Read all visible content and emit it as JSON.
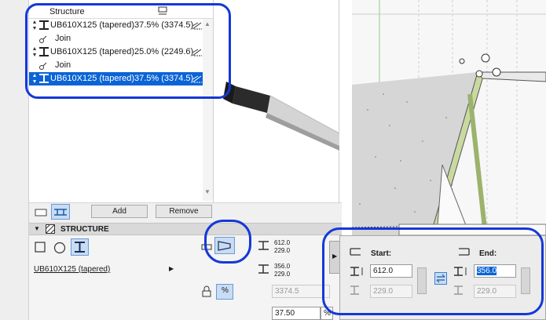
{
  "segments": {
    "header": "Structure",
    "rows": [
      {
        "type": "segment",
        "name": "UB610X125 (tapered)",
        "value": "37.5% (3374.5)",
        "selected": false
      },
      {
        "type": "join",
        "name": "Join"
      },
      {
        "type": "segment",
        "name": "UB610X125 (tapered)",
        "value": "25.0% (2249.6)",
        "selected": false
      },
      {
        "type": "join",
        "name": "Join"
      },
      {
        "type": "segment",
        "name": "UB610X125 (tapered)",
        "value": "37.5% (3374.5)",
        "selected": true
      }
    ]
  },
  "buttons": {
    "add": "Add",
    "remove": "Remove"
  },
  "section": {
    "title": "STRUCTURE"
  },
  "profile": {
    "selected": "UB610X125 (tapered)"
  },
  "dims": {
    "pair1": [
      "612.0",
      "229.0"
    ],
    "pair2": [
      "356.0",
      "229.0"
    ],
    "length": "3374.5",
    "percent": "37.50",
    "percent_unit": "%",
    "percent_btn": "%"
  },
  "popover": {
    "start_label": "Start:",
    "end_label": "End:",
    "start_height": "612.0",
    "start_width": "229.0",
    "end_height": "356.0",
    "end_width": "229.0"
  },
  "colors": {
    "selection": "#0a64d6",
    "highlight": "#1438d8",
    "plan_fill": "#d6d6d6",
    "plan_green": "#c9d9a0"
  }
}
